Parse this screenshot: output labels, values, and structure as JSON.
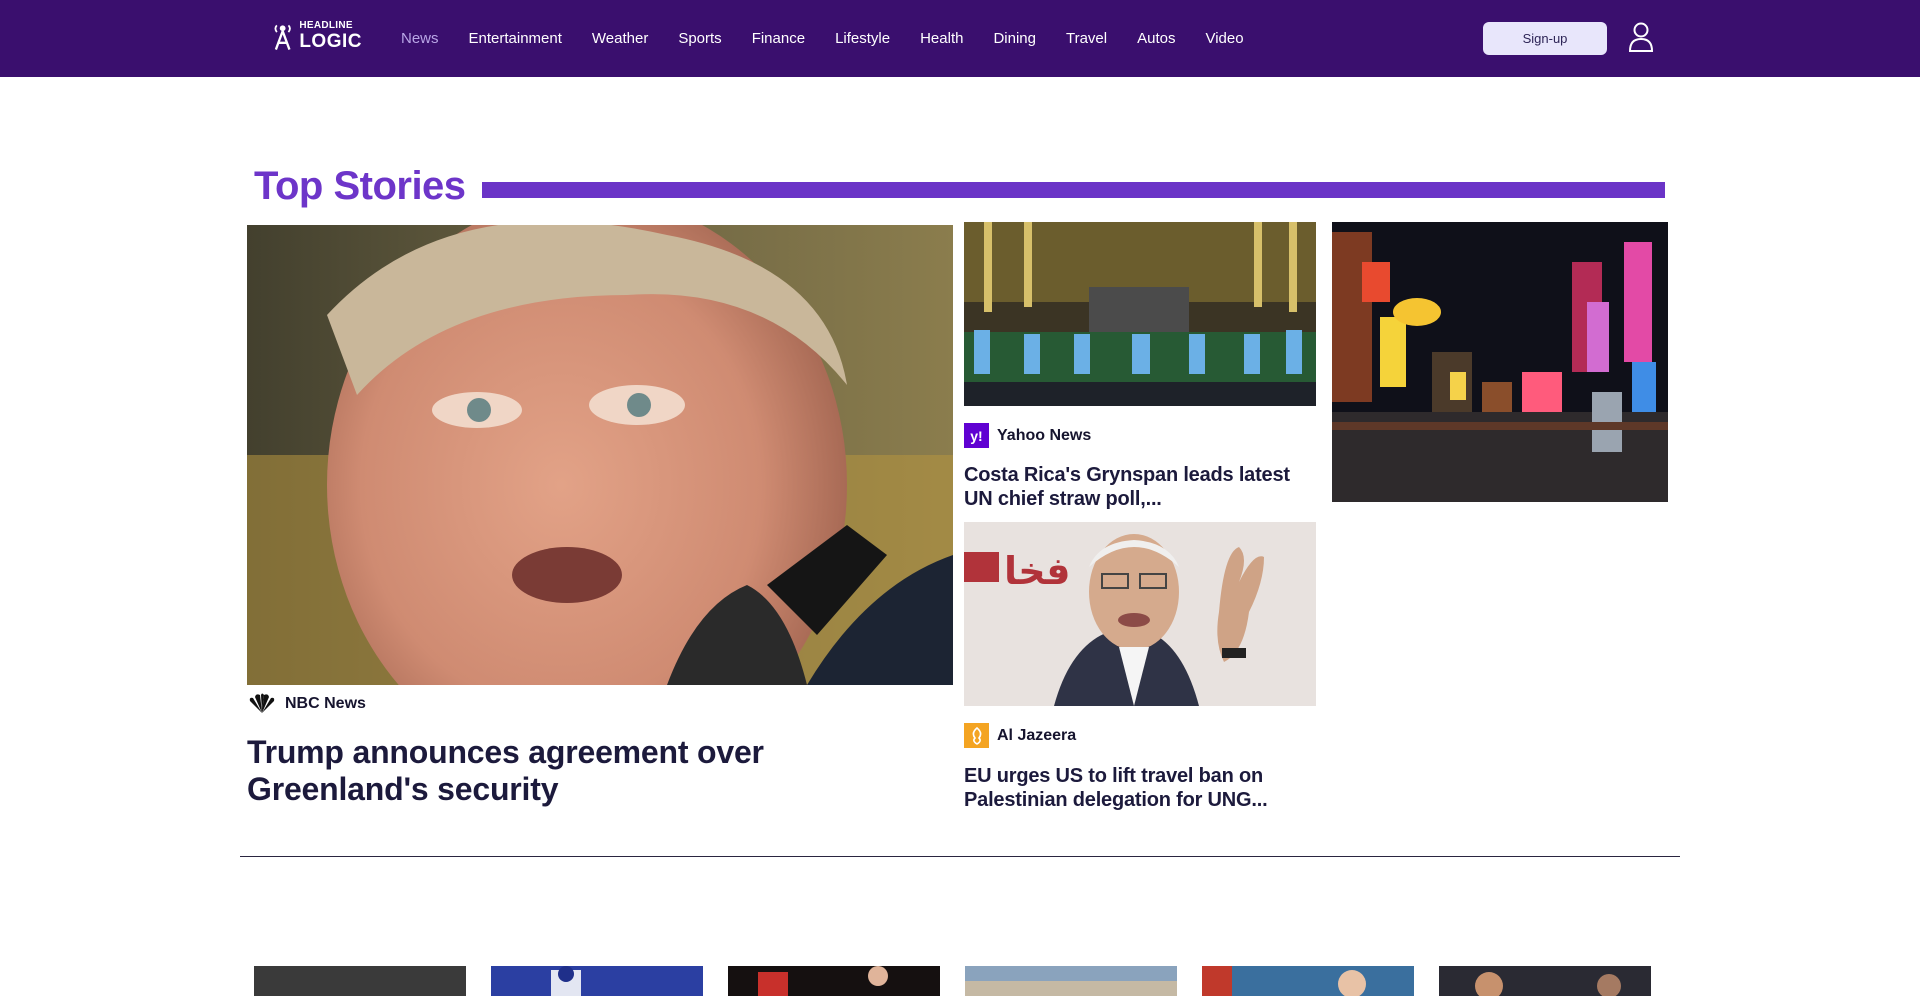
{
  "header": {
    "logo_top": "HEADLINE",
    "logo_bottom": "LOGIC",
    "nav": [
      {
        "label": "News",
        "active": true
      },
      {
        "label": "Entertainment"
      },
      {
        "label": "Weather"
      },
      {
        "label": "Sports"
      },
      {
        "label": "Finance"
      },
      {
        "label": "Lifestyle"
      },
      {
        "label": "Health"
      },
      {
        "label": "Dining"
      },
      {
        "label": "Travel"
      },
      {
        "label": "Autos"
      },
      {
        "label": "Video"
      }
    ],
    "signup_label": "Sign-up",
    "user_icon": "user-icon"
  },
  "top_stories": {
    "title": "Top Stories",
    "accent_color": "#6b34c7",
    "main": {
      "source": "NBC News",
      "source_icon": "peacock-icon",
      "headline": "Trump announces agreement over Greenland's security"
    },
    "secondary": [
      {
        "source": "Yahoo News",
        "source_icon": "yahoo-icon",
        "headline": "Costa Rica's Grynspan leads latest UN chief straw poll,..."
      },
      {
        "source": "Al Jazeera",
        "source_icon": "al-jazeera-icon",
        "headline": "EU urges US to lift travel ban on Palestinian delegation for UNG..."
      }
    ]
  },
  "colors": {
    "header_bg": "#3a0f6e",
    "nav_active": "#b9a6e6",
    "signup_bg": "#e8e6fb",
    "title": "#6d35c9"
  }
}
